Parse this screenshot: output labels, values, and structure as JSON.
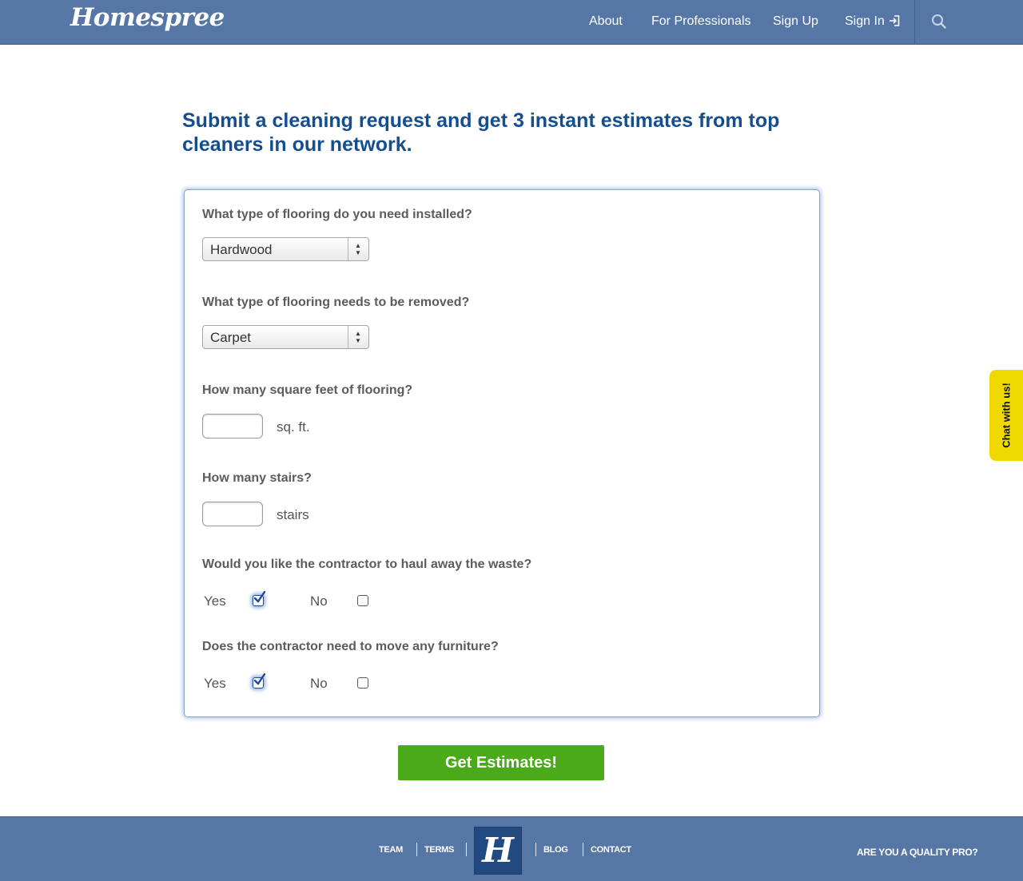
{
  "header": {
    "logo": "Homespree",
    "nav": {
      "about": "About",
      "for_professionals": "For Professionals",
      "sign_up": "Sign Up",
      "sign_in": "Sign In"
    },
    "icons": {
      "sign_in": "sign-in-icon",
      "search": "search-icon"
    }
  },
  "headline": "Submit a cleaning request and get 3 instant estimates from top cleaners in our network.",
  "form": {
    "flooring_installed": {
      "question": "What type of flooring do you need installed?",
      "selected": "Hardwood"
    },
    "flooring_removed": {
      "question": "What type of flooring needs to be removed?",
      "selected": "Carpet"
    },
    "square_feet": {
      "question": "How many square feet of flooring?",
      "value": "",
      "unit": "sq. ft."
    },
    "stairs": {
      "question": "How many stairs?",
      "value": "",
      "unit": "stairs"
    },
    "haul_waste": {
      "question": "Would you like the contractor to haul away the waste?",
      "yes_label": "Yes",
      "no_label": "No",
      "yes_checked": true,
      "no_checked": false
    },
    "move_furniture": {
      "question": "Does the contractor need to move any furniture?",
      "yes_label": "Yes",
      "no_label": "No",
      "yes_checked": true,
      "no_checked": false
    }
  },
  "submit_label": "Get Estimates!",
  "chat_tab": "Chat with us!",
  "footer": {
    "links": {
      "team": "TEAM",
      "terms": "TERMS",
      "blog": "BLOG",
      "contact": "CONTACT"
    },
    "logo_letter": "H",
    "quality_pro": "ARE YOU A QUALITY PRO?"
  },
  "colors": {
    "header_bg": "#5677a6",
    "headline": "#154e8f",
    "submit_bg": "#4aaa1a",
    "chat_bg": "#f0d900",
    "footer_logo_bg": "#234a80"
  }
}
